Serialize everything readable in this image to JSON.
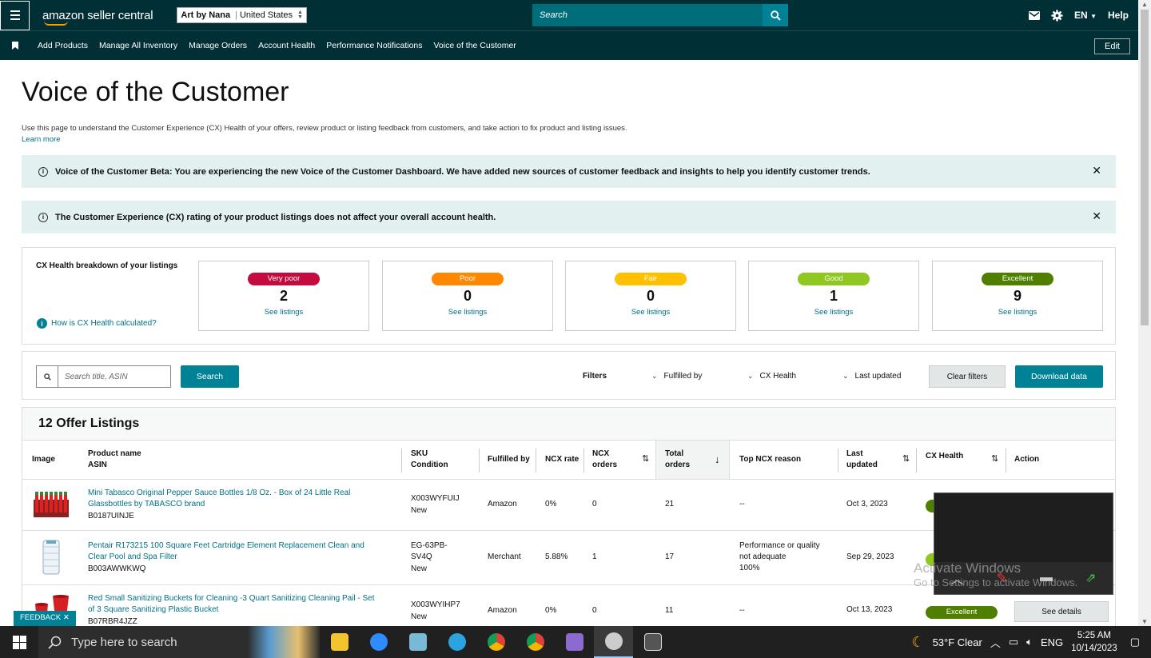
{
  "header": {
    "logo": "amazon seller central",
    "account_store": "Art by Nana",
    "account_region": "United States",
    "search_placeholder": "Search",
    "language": "EN",
    "help": "Help"
  },
  "nav": {
    "items": [
      "Add Products",
      "Manage All Inventory",
      "Manage Orders",
      "Account Health",
      "Performance Notifications",
      "Voice of the Customer"
    ],
    "edit": "Edit"
  },
  "page": {
    "title": "Voice of the Customer",
    "description": "Use this page to understand the Customer Experience (CX) Health of your offers, review product or listing feedback from customers, and take action to fix product and listing issues.",
    "learn_more": "Learn more"
  },
  "banners": [
    "Voice of the Customer Beta: You are experiencing the new Voice of the Customer Dashboard. We have added new sources of customer feedback and insights to help you identify customer trends.",
    "The Customer Experience (CX) rating of your product listings does not affect your overall account health."
  ],
  "cx_health": {
    "title": "CX Health breakdown of your listings",
    "how_link": "How is CX Health calculated?",
    "see_listings": "See listings",
    "cards": [
      {
        "label": "Very poor",
        "count": "2",
        "color": "#c40a3f"
      },
      {
        "label": "Poor",
        "count": "0",
        "color": "#ff8800"
      },
      {
        "label": "Fair",
        "count": "0",
        "color": "#ffc000"
      },
      {
        "label": "Good",
        "count": "1",
        "color": "#8ec820"
      },
      {
        "label": "Excellent",
        "count": "9",
        "color": "#507f00"
      }
    ]
  },
  "filters": {
    "search_placeholder": "Search title, ASIN",
    "search_button": "Search",
    "label": "Filters",
    "dropdowns": [
      "Fulfilled by",
      "CX Health",
      "Last updated"
    ],
    "clear": "Clear filters",
    "download": "Download data"
  },
  "table": {
    "title": "12 Offer Listings",
    "columns": {
      "image": "Image",
      "product_name": "Product name",
      "asin": "ASIN",
      "sku": "SKU",
      "condition": "Condition",
      "fulfilled_by": "Fulfilled by",
      "ncx_rate": "NCX rate",
      "ncx_orders_1": "NCX",
      "ncx_orders_2": "orders",
      "total_orders_1": "Total",
      "total_orders_2": "orders",
      "top_ncx_reason": "Top NCX reason",
      "last_updated_1": "Last",
      "last_updated_2": "updated",
      "cx_health": "CX Health",
      "action": "Action"
    },
    "rows": [
      {
        "name_1": "Mini Tabasco Original Pepper Sauce Bottles 1/8 Oz. - Box of 24 Little Real",
        "name_2": "Glassbottles by TABASCO brand",
        "asin": "B0187UINJE",
        "sku_1": "X003WYFUIJ",
        "sku_2": "",
        "condition": "New",
        "fulfilled": "Amazon",
        "ncx_rate": "0%",
        "ncx_orders": "0",
        "total_orders": "21",
        "reason_1": "--",
        "reason_2": "",
        "reason_3": "",
        "updated": "Oct 3, 2023"
      },
      {
        "name_1": "Pentair R173215 100 Square Feet Cartridge Element Replacement Clean and",
        "name_2": "Clear Pool and Spa Filter",
        "asin": "B003AWWKWQ",
        "sku_1": "EG-63PB-",
        "sku_2": "SV4Q",
        "condition": "New",
        "fulfilled": "Merchant",
        "ncx_rate": "5.88%",
        "ncx_orders": "1",
        "total_orders": "17",
        "reason_1": "Performance or quality",
        "reason_2": "not adequate",
        "reason_3": "100%",
        "updated": "Sep 29, 2023"
      },
      {
        "name_1": "Red Small Sanitizing Buckets for Cleaning -3 Quart Sanitizing Cleaning Pail - Set",
        "name_2": "of 3 Square Sanitizing Plastic Bucket",
        "asin": "B07RBR4JZZ",
        "sku_1": "X003WYIHP7",
        "sku_2": "",
        "condition": "New",
        "fulfilled": "Amazon",
        "ncx_rate": "0%",
        "ncx_orders": "0",
        "total_orders": "11",
        "reason_1": "--",
        "reason_2": "",
        "reason_3": "",
        "updated": "Oct 13, 2023",
        "cx": "Excellent",
        "action": "See details"
      }
    ]
  },
  "overlay": {
    "activate_title": "Activate Windows",
    "activate_sub": "Go to Settings to activate Windows."
  },
  "feedback": "FEEDBACK ✕",
  "taskbar": {
    "search": "Type here to search",
    "weather": "53°F  Clear",
    "lang": "ENG",
    "time": "5:25 AM",
    "date": "10/14/2023"
  }
}
